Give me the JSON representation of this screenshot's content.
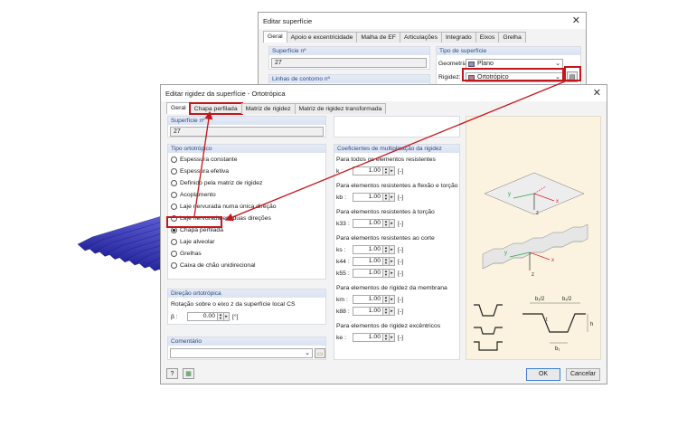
{
  "back": {
    "title": "Editar superfície",
    "tabs": [
      "Geral",
      "Apoio e excentricidade",
      "Malha de EF",
      "Articulações",
      "Integrado",
      "Eixos",
      "Grelha"
    ],
    "surface_no_head": "Superfície nº",
    "surface_no": "27",
    "contour_head": "Linhas de contorno nº",
    "type_head": "Tipo de superfície",
    "geometry_label": "Geometria:",
    "geometry_value": "Plano",
    "stiffness_label": "Rigidez:",
    "stiffness_value": "Ortotrópico"
  },
  "front": {
    "title": "Editar rigidez da superfície - Ortotrópica",
    "tabs": [
      "Geral",
      "Chapa perfilada",
      "Matriz de rigidez",
      "Matriz de rigidez transformada"
    ],
    "surface_no_head": "Superfície nº",
    "surface_no": "27",
    "ortho_head": "Tipo ortotrópico",
    "ortho_options": [
      "Espessura constante",
      "Espessura efetiva",
      "Definido pela matriz de rigidez",
      "Acoplamento",
      "Laje nervurada numa única direção",
      "Laje nervurada em duas direções",
      "Chapa perfilada",
      "Laje alveolar",
      "Grelhas",
      "Caixa de chão unidirecional"
    ],
    "selected_option": "Chapa perfilada",
    "dir_head": "Direção ortotrópica",
    "rotation_label": "Rotação sobre o eixo z da superfície local CS",
    "beta_label": "β :",
    "beta_value": "0.00",
    "beta_unit": "[°]",
    "comment_head": "Comentário",
    "coef_head": "Coeficientes de multiplicação da rigidez",
    "coef_groups": [
      {
        "label": "Para todos os elementos resistentes",
        "rows": [
          {
            "sym": "k :",
            "val": "1.00",
            "unit": "[-]"
          }
        ]
      },
      {
        "label": "Para elementos resistentes a flexão e torção",
        "rows": [
          {
            "sym": "kb :",
            "val": "1.00",
            "unit": "[-]"
          }
        ]
      },
      {
        "label": "Para elementos resistentes à torção",
        "rows": [
          {
            "sym": "k33 :",
            "val": "1.00",
            "unit": "[-]"
          }
        ]
      },
      {
        "label": "Para elementos resistentes ao corte",
        "rows": [
          {
            "sym": "ks :",
            "val": "1.00",
            "unit": "[-]"
          },
          {
            "sym": "k44 :",
            "val": "1.00",
            "unit": "[-]"
          },
          {
            "sym": "k55 :",
            "val": "1.00",
            "unit": "[-]"
          }
        ]
      },
      {
        "label": "Para elementos de rigidez da membrana",
        "rows": [
          {
            "sym": "km :",
            "val": "1.00",
            "unit": "[-]"
          },
          {
            "sym": "k88 :",
            "val": "1.00",
            "unit": "[-]"
          }
        ]
      },
      {
        "label": "Para elementos de rigidez excêntricos",
        "rows": [
          {
            "sym": "ke :",
            "val": "1.00",
            "unit": "[-]"
          }
        ]
      }
    ],
    "ok_label": "OK",
    "cancel_label": "Cancelar",
    "diagram_labels": {
      "y": "y",
      "x": "x",
      "z": "z",
      "b12a": "b₁/2",
      "b12b": "b₁/2",
      "t": "t",
      "h": "h",
      "b1": "b₁"
    }
  },
  "colors": {
    "highlight": "#c4161c",
    "group_head": "#2b4a86",
    "geometry_swatch": "#8e8edb",
    "stiffness_swatch": "#c07d8c",
    "deck": "#3d3db8"
  }
}
